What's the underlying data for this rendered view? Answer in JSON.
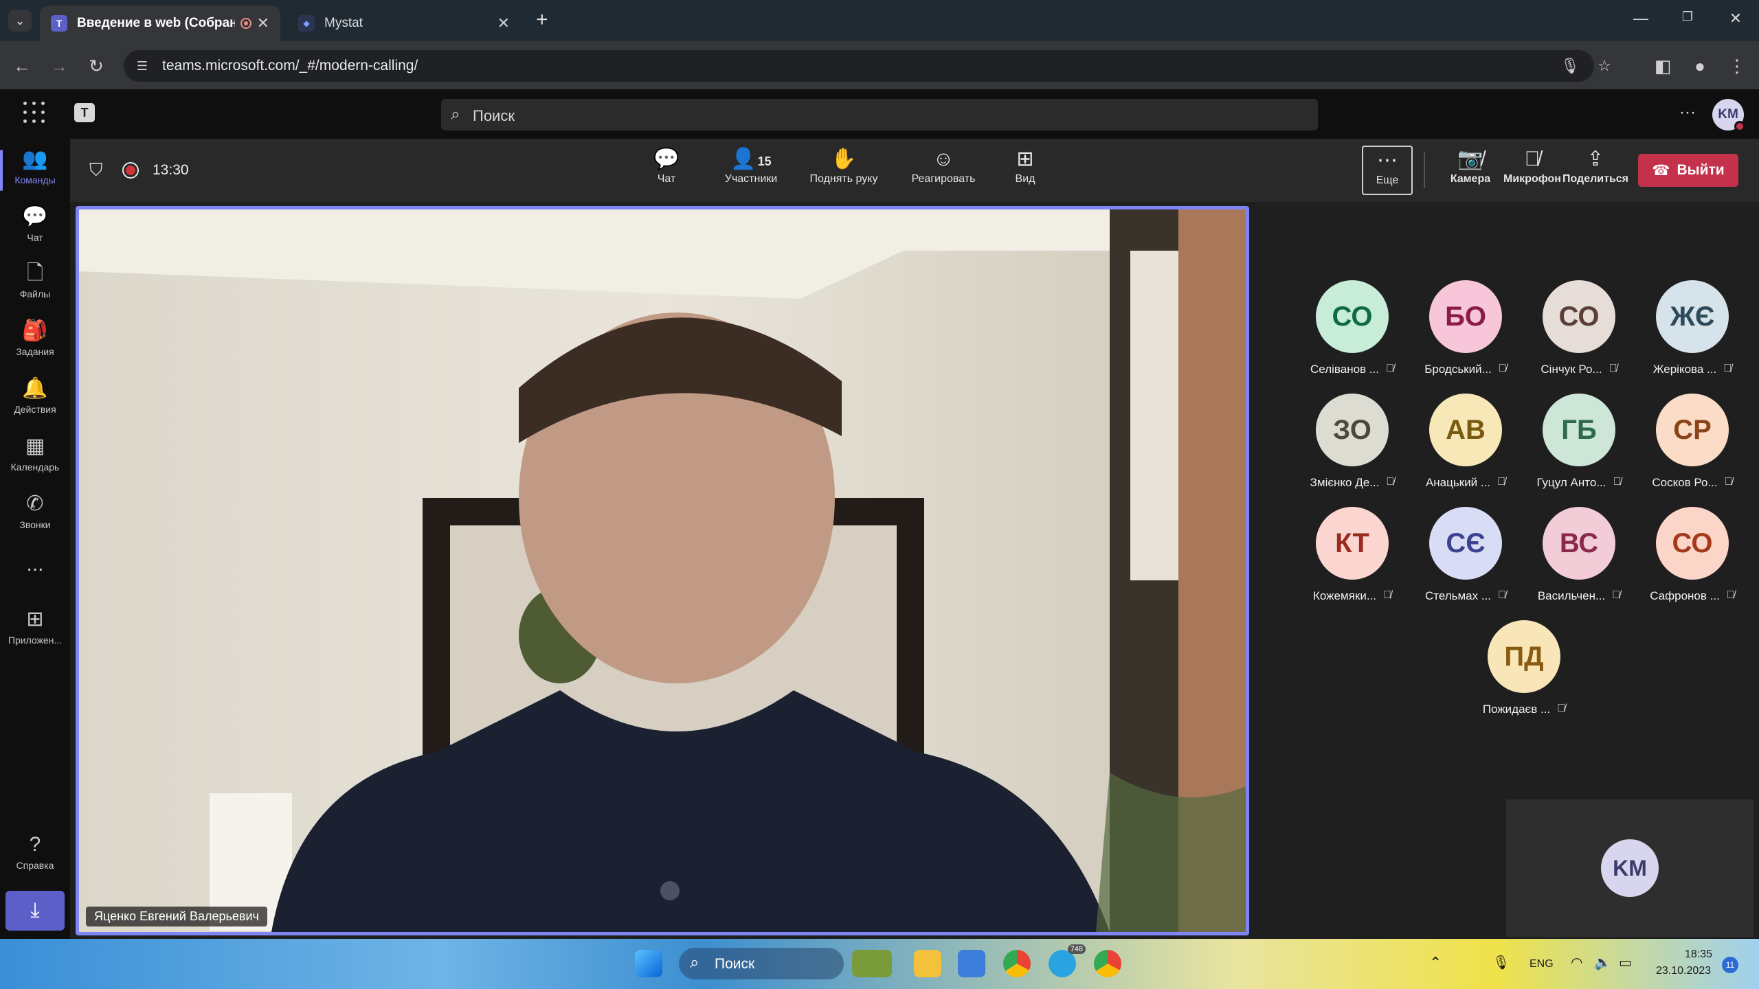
{
  "browser": {
    "tabs": [
      {
        "title": "Введение в web (Собрание)",
        "active": true,
        "favicon": "teams-icon"
      },
      {
        "title": "Mystat",
        "active": false,
        "favicon": "mystat-icon"
      }
    ],
    "url": "teams.microsoft.com/_#/modern-calling/"
  },
  "teams": {
    "search_placeholder": "Поиск",
    "more_label": "···",
    "user_initials": "KM"
  },
  "rail": [
    {
      "label": "Команды",
      "icon": "teams-icon",
      "active": true
    },
    {
      "label": "Чат",
      "icon": "chat-icon"
    },
    {
      "label": "Файлы",
      "icon": "files-icon"
    },
    {
      "label": "Задания",
      "icon": "assignments-icon"
    },
    {
      "label": "Действия",
      "icon": "bell-icon"
    },
    {
      "label": "Календарь",
      "icon": "calendar-icon"
    },
    {
      "label": "Звонки",
      "icon": "phone-icon"
    },
    {
      "label": "...",
      "icon": "more-icon"
    },
    {
      "label": "Приложен...",
      "icon": "apps-icon"
    },
    {
      "label": "Справка",
      "icon": "help-icon"
    }
  ],
  "meeting": {
    "time": "13:30",
    "participants_count": "15",
    "toolbar": {
      "chat": "Чат",
      "participants": "Участники",
      "raise_hand": "Поднять руку",
      "react": "Реагировать",
      "view": "Вид",
      "more": "Еще",
      "camera": "Камера",
      "mic": "Микрофон",
      "share": "Поделиться",
      "leave": "Выйти"
    },
    "presenter_name": "Яценко Евгений Валерьевич",
    "participants": [
      {
        "initials": "СО",
        "name": "Селіванов ...",
        "bg": "#c7ecd8",
        "fg": "#0e6b47"
      },
      {
        "initials": "БО",
        "name": "Бродський...",
        "bg": "#f8c6d9",
        "fg": "#8a1c45"
      },
      {
        "initials": "СО",
        "name": "Сінчук Ро...",
        "bg": "#e6dcd8",
        "fg": "#5a3f38"
      },
      {
        "initials": "ЖЄ",
        "name": "Жерікова ...",
        "bg": "#d6e3ea",
        "fg": "#2d4b5a"
      },
      {
        "initials": "ЗО",
        "name": "Змієнко Де...",
        "bg": "#dcdcd2",
        "fg": "#4a4a3c"
      },
      {
        "initials": "АВ",
        "name": "Анацький ...",
        "bg": "#f8e8b8",
        "fg": "#7a5a10"
      },
      {
        "initials": "ГБ",
        "name": "Гуцул Анто...",
        "bg": "#cde6d8",
        "fg": "#2f6a4a"
      },
      {
        "initials": "СР",
        "name": "Сосков Ро...",
        "bg": "#fbdcc6",
        "fg": "#8a4418"
      },
      {
        "initials": "КТ",
        "name": "Кожемяки...",
        "bg": "#fbd6d0",
        "fg": "#9b2b1f"
      },
      {
        "initials": "СЄ",
        "name": "Стельмах ...",
        "bg": "#d8dcf5",
        "fg": "#3b4390"
      },
      {
        "initials": "ВС",
        "name": "Васильчен...",
        "bg": "#f2cdd8",
        "fg": "#8a2a4a"
      },
      {
        "initials": "СО",
        "name": "Сафронов ...",
        "bg": "#fbd5c8",
        "fg": "#a43a1c"
      },
      {
        "initials": "ПД",
        "name": "Пожидаєв ...",
        "bg": "#f8e6b8",
        "fg": "#8a5a10"
      }
    ],
    "self_initials": "KM"
  },
  "taskbar": {
    "search_label": "Поиск",
    "lang": "ENG",
    "time": "18:35",
    "date": "23.10.2023",
    "telegram_badge": "748",
    "notif_badge": "11"
  }
}
